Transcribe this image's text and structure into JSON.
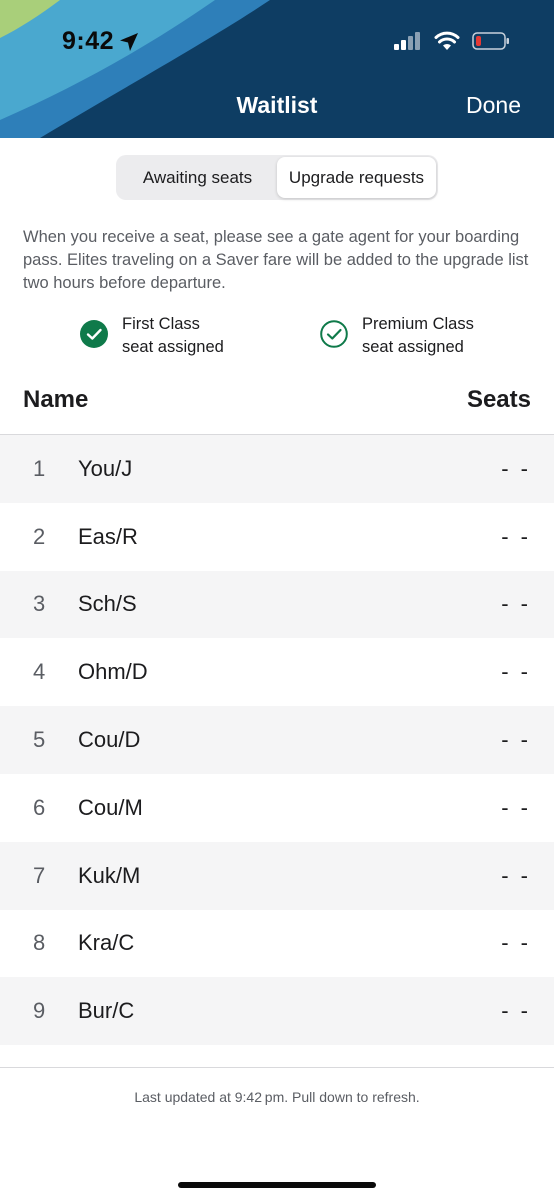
{
  "status_bar": {
    "time": "9:42"
  },
  "nav": {
    "title": "Waitlist",
    "done_label": "Done"
  },
  "segments": [
    {
      "label": "Awaiting seats",
      "active": false
    },
    {
      "label": "Upgrade requests",
      "active": true
    }
  ],
  "info_text": "When you receive a seat, please see a gate agent for your boarding pass. Elites traveling on a Saver fare will be added to the upgrade list two hours before departure.",
  "legend": {
    "first": {
      "line1": "First Class",
      "line2": "seat assigned"
    },
    "premium": {
      "line1": "Premium Class",
      "line2": "seat assigned"
    }
  },
  "columns": {
    "name": "Name",
    "seats": "Seats"
  },
  "rows": [
    {
      "num": "1",
      "name": "You/J",
      "seats": "- -"
    },
    {
      "num": "2",
      "name": "Eas/R",
      "seats": "- -"
    },
    {
      "num": "3",
      "name": "Sch/S",
      "seats": "- -"
    },
    {
      "num": "4",
      "name": "Ohm/D",
      "seats": "- -"
    },
    {
      "num": "5",
      "name": "Cou/D",
      "seats": "- -"
    },
    {
      "num": "6",
      "name": "Cou/M",
      "seats": "- -"
    },
    {
      "num": "7",
      "name": "Kuk/M",
      "seats": "- -"
    },
    {
      "num": "8",
      "name": "Kra/C",
      "seats": "- -"
    },
    {
      "num": "9",
      "name": "Bur/C",
      "seats": "- -"
    }
  ],
  "footer_text": "Last updated at 9:42 pm. Pull down to refresh.",
  "colors": {
    "header": "#0e3d63",
    "accent_green": "#0f7a4a",
    "battery_low": "#e53935"
  }
}
